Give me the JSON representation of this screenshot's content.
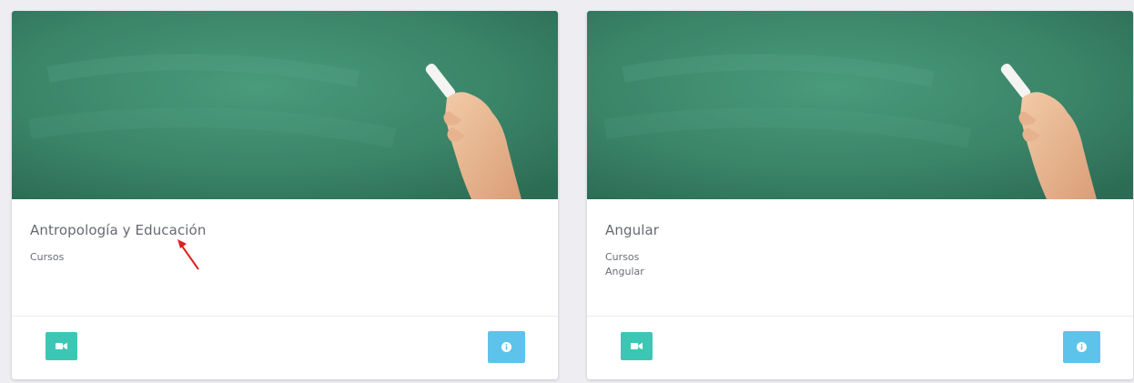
{
  "cards": [
    {
      "title": "Antropología y Educación",
      "subtitle_lines": [
        "Cursos"
      ],
      "video_icon": "video-camera-icon",
      "info_icon": "info-circle-icon"
    },
    {
      "title": "Angular",
      "subtitle_lines": [
        "Cursos",
        "Angular"
      ],
      "video_icon": "video-camera-icon",
      "info_icon": "info-circle-icon"
    }
  ],
  "colors": {
    "video_button": "#3cc7b5",
    "info_button": "#5ec3ea",
    "chalkboard": "#3c8c6e",
    "annotation_arrow": "#e02020"
  }
}
